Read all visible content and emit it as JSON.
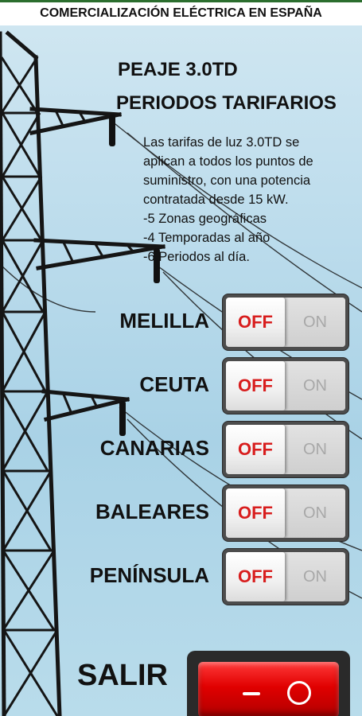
{
  "header": {
    "title": "COMERCIALIZACIÓN ELÉCTRICA EN ESPAÑA"
  },
  "main": {
    "title_line1": "PEAJE 3.0TD",
    "title_line2": "PERIODOS TARIFARIOS",
    "description": [
      "Las tarifas de luz 3.0TD se",
      "aplican a todos los puntos de",
      "suministro, con  una potencia",
      "contratada desde 15 kW.",
      "-5 Zonas geográficas",
      "-4 Temporadas al año",
      "-6 Periodos al día."
    ]
  },
  "regions": [
    {
      "label": "MELILLA",
      "off": "OFF",
      "on": "ON",
      "state": "off"
    },
    {
      "label": "CEUTA",
      "off": "OFF",
      "on": "ON",
      "state": "off"
    },
    {
      "label": "CANARIAS",
      "off": "OFF",
      "on": "ON",
      "state": "off"
    },
    {
      "label": "BALEARES",
      "off": "OFF",
      "on": "ON",
      "state": "off"
    },
    {
      "label": "PENÍNSULA",
      "off": "OFF",
      "on": "ON",
      "state": "off"
    }
  ],
  "exit": {
    "label": "SALIR",
    "switch_color": "#e00000"
  },
  "colors": {
    "header_accent": "#2b6e2e",
    "off_text": "#d81d1d"
  }
}
